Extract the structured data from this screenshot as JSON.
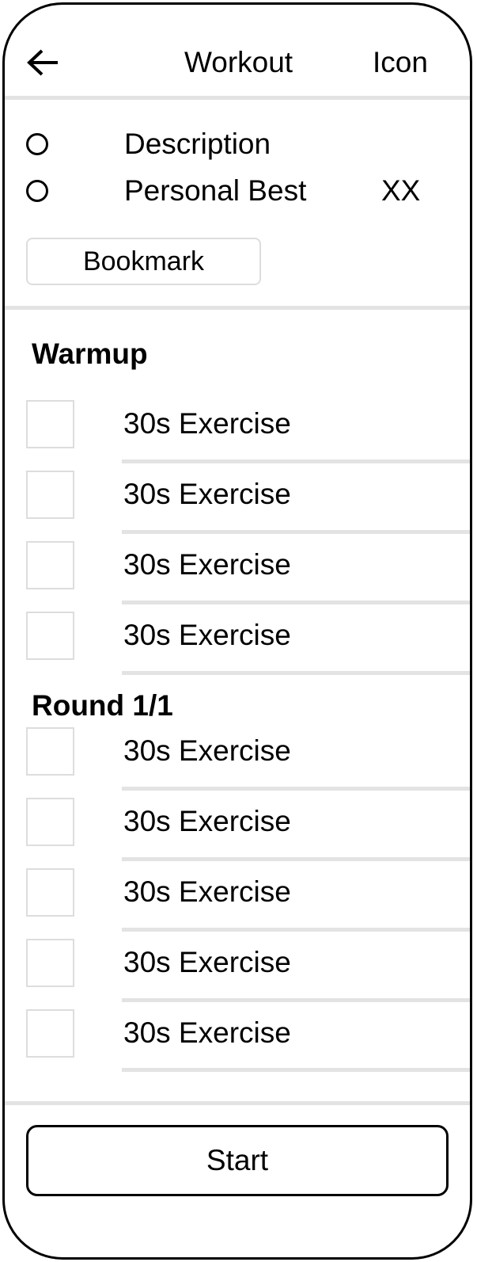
{
  "header": {
    "title": "Workout",
    "icon_label": "Icon",
    "back_icon": "arrow-left-icon"
  },
  "info": {
    "description_label": "Description",
    "personal_best_label": "Personal Best",
    "personal_best_value": "XX",
    "bookmark_label": "Bookmark"
  },
  "warmup": {
    "title": "Warmup",
    "items": [
      {
        "label": "30s Exercise"
      },
      {
        "label": "30s Exercise"
      },
      {
        "label": "30s Exercise"
      },
      {
        "label": "30s Exercise"
      }
    ]
  },
  "round": {
    "title": "Round 1/1",
    "items": [
      {
        "label": "30s Exercise"
      },
      {
        "label": "30s Exercise"
      },
      {
        "label": "30s Exercise"
      },
      {
        "label": "30s Exercise"
      },
      {
        "label": "30s Exercise"
      }
    ]
  },
  "footer": {
    "start_label": "Start"
  },
  "colors": {
    "border": "#000000",
    "divider": "#e3e3e3",
    "checkbox_border": "#dddddd"
  }
}
